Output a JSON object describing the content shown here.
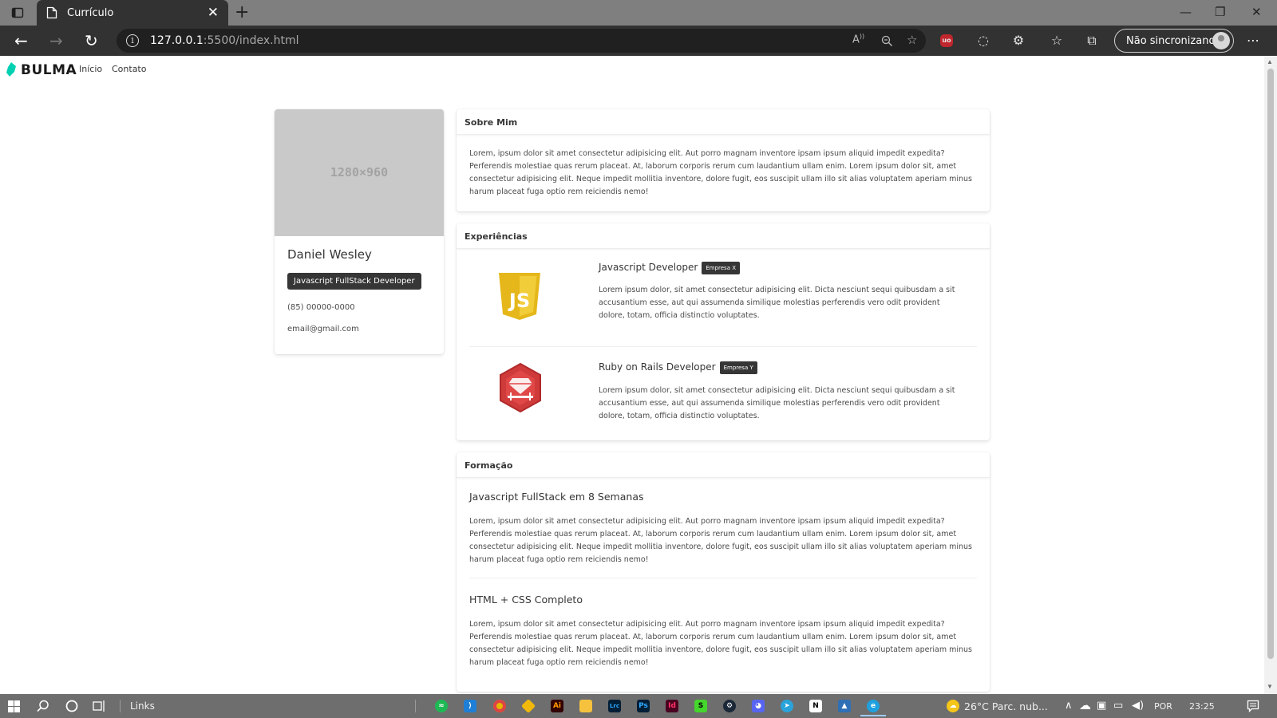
{
  "browser": {
    "tab_title": "Currículo",
    "tab_close": "✕",
    "new_tab": "+",
    "url_host": "127.0.0.1",
    "url_path": ":5500/index.html",
    "sync_label": "Não sincronizando",
    "window_controls": {
      "minimize": "—",
      "restore": "❐",
      "close": "✕"
    },
    "nav": {
      "back": "←",
      "forward": "→",
      "reload": "↻",
      "more": "⋯"
    }
  },
  "site": {
    "brand": "BULMA",
    "brand_color": "#00d1b2",
    "nav_links": [
      "Início",
      "Contato"
    ]
  },
  "profile": {
    "image_placeholder": "1280×960",
    "name": "Daniel Wesley",
    "role_tag": "Javascript FullStack Developer",
    "phone": "(85) 00000-0000",
    "email": "email@gmail.com"
  },
  "about": {
    "title": "Sobre Mim",
    "text": "Lorem, ipsum dolor sit amet consectetur adipisicing elit. Aut porro magnam inventore ipsam ipsum aliquid impedit expedita? Perferendis molestiae quas rerum placeat. At, laborum corporis rerum cum laudantium ullam enim. Lorem ipsum dolor sit, amet consectetur adipisicing elit. Neque impedit mollitia inventore, dolore fugit, eos suscipit ullam illo sit alias voluptatem aperiam minus harum placeat fuga optio rem reiciendis nemo!"
  },
  "experience": {
    "title": "Experiências",
    "items": [
      {
        "icon": "javascript-logo",
        "role": "Javascript Developer",
        "company": "Empresa X",
        "text": "Lorem ipsum dolor, sit amet consectetur adipisicing elit. Dicta nesciunt sequi quibusdam a sit accusantium esse, aut qui assumenda similique molestias perferendis vero odit provident dolore, totam, officia distinctio voluptates."
      },
      {
        "icon": "ruby-on-rails-logo",
        "role": "Ruby on Rails Developer",
        "company": "Empresa Y",
        "text": "Lorem ipsum dolor, sit amet consectetur adipisicing elit. Dicta nesciunt sequi quibusdam a sit accusantium esse, aut qui assumenda similique molestias perferendis vero odit provident dolore, totam, officia distinctio voluptates."
      }
    ]
  },
  "education": {
    "title": "Formação",
    "items": [
      {
        "course": "Javascript FullStack em 8 Semanas",
        "text": "Lorem, ipsum dolor sit amet consectetur adipisicing elit. Aut porro magnam inventore ipsam ipsum aliquid impedit expedita? Perferendis molestiae quas rerum placeat. At, laborum corporis rerum cum laudantium ullam enim. Lorem ipsum dolor sit, amet consectetur adipisicing elit. Neque impedit mollitia inventore, dolore fugit, eos suscipit ullam illo sit alias voluptatem aperiam minus harum placeat fuga optio rem reiciendis nemo!"
      },
      {
        "course": "HTML + CSS Completo",
        "text": "Lorem, ipsum dolor sit amet consectetur adipisicing elit. Aut porro magnam inventore ipsam ipsum aliquid impedit expedita? Perferendis molestiae quas rerum placeat. At, laborum corporis rerum cum laudantium ullam enim. Lorem ipsum dolor sit, amet consectetur adipisicing elit. Neque impedit mollitia inventore, dolore fugit, eos suscipit ullam illo sit alias voluptatem aperiam minus harum placeat fuga optio rem reiciendis nemo!"
      }
    ]
  },
  "taskbar": {
    "links_label": "Links",
    "weather": "26°C  Parc. nub...",
    "language": "POR",
    "time": "23:25",
    "apps": [
      "spotify-icon",
      "vscode-icon",
      "chrome-icon",
      "binance-icon",
      "illustrator-icon",
      "file-explorer-icon",
      "lightroom-icon",
      "photoshop-icon",
      "indesign-icon",
      "razer-icon",
      "steam-icon",
      "discord-icon",
      "telegram-icon",
      "notion-icon",
      "photos-icon",
      "edge-icon"
    ]
  }
}
